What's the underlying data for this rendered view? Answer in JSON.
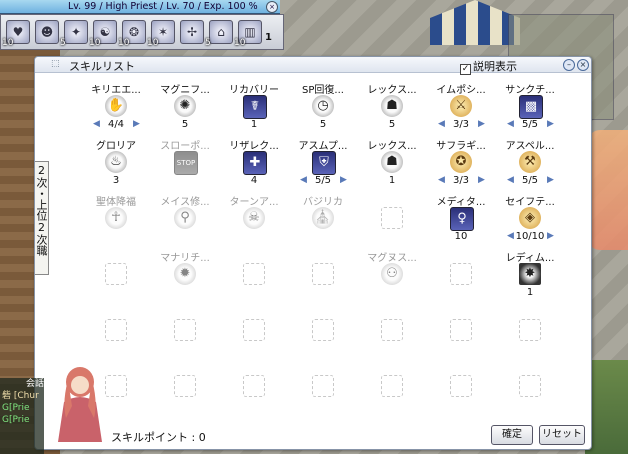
{
  "status_bar": {
    "text": "Lv. 99 / High Priest / Lv. 70 / Exp. 100 %"
  },
  "hotbar": {
    "slots": [
      {
        "icon": "heart-icon",
        "glyph": "♥",
        "count": "10"
      },
      {
        "icon": "face-icon",
        "glyph": "☻",
        "count": ""
      },
      {
        "icon": "skill-icon",
        "glyph": "✦",
        "count": "5"
      },
      {
        "icon": "skill-icon",
        "glyph": "☯",
        "count": "10"
      },
      {
        "icon": "skill-icon",
        "glyph": "❂",
        "count": "10"
      },
      {
        "icon": "skill-icon",
        "glyph": "✶",
        "count": "10"
      },
      {
        "icon": "skill-icon",
        "glyph": "✢",
        "count": ""
      },
      {
        "icon": "skill-icon",
        "glyph": "⌂",
        "count": "5"
      },
      {
        "icon": "skill-icon",
        "glyph": "▥",
        "count": "10"
      }
    ],
    "page_number": "1"
  },
  "skill_window": {
    "title": "スキルリスト",
    "description_toggle": "説明表示",
    "side_tab": "2次・上位2次職",
    "skill_points_label": "スキルポイント : 0",
    "confirm_label": "確定",
    "reset_label": "リセット",
    "rows": [
      [
        {
          "name": "キリエエ...",
          "glyph": "✋",
          "style": "round",
          "level": "4/4",
          "arrows": true
        },
        {
          "name": "マグニフ...",
          "glyph": "✺",
          "style": "round",
          "level": "5"
        },
        {
          "name": "リカバリー",
          "glyph": "☤",
          "style": "box",
          "level": "1"
        },
        {
          "name": "SP回復...",
          "glyph": "◷",
          "style": "round",
          "level": "5"
        },
        {
          "name": "レックス...",
          "glyph": "☗",
          "style": "round",
          "level": "5"
        },
        {
          "name": "イムポシ...",
          "glyph": "⚔",
          "style": "gold",
          "level": "3/3",
          "arrows": true
        },
        {
          "name": "サンクチ...",
          "glyph": "▩",
          "style": "box",
          "level": "5/5",
          "arrows": true
        }
      ],
      [
        {
          "name": "グロリア",
          "glyph": "♨",
          "style": "round",
          "level": "3"
        },
        {
          "name": "スローポ...",
          "glyph": "STOP",
          "style": "box",
          "level": "",
          "dim": true
        },
        {
          "name": "リザレク...",
          "glyph": "✚",
          "style": "box",
          "level": "4"
        },
        {
          "name": "アスムプ...",
          "glyph": "⛨",
          "style": "box",
          "level": "5/5",
          "arrows": true
        },
        {
          "name": "レックス...",
          "glyph": "☗",
          "style": "round",
          "level": "1"
        },
        {
          "name": "サフラギ...",
          "glyph": "✪",
          "style": "gold",
          "level": "3/3",
          "arrows": true
        },
        {
          "name": "アスペル...",
          "glyph": "⚒",
          "style": "gold",
          "level": "5/5",
          "arrows": true
        }
      ],
      [
        {
          "name": "聖体降福",
          "glyph": "☥",
          "style": "round",
          "level": "",
          "dim": true
        },
        {
          "name": "メイス修...",
          "glyph": "⚲",
          "style": "round",
          "level": "",
          "dim": true
        },
        {
          "name": "ターンア...",
          "glyph": "☠",
          "style": "round",
          "level": "",
          "dim": true
        },
        {
          "name": "バジリカ",
          "glyph": "⛪",
          "style": "round",
          "level": "",
          "dim": true
        },
        {
          "name": "",
          "glyph": "",
          "style": "empty",
          "level": ""
        },
        {
          "name": "メディタ...",
          "glyph": "♀",
          "style": "box",
          "level": "10"
        },
        {
          "name": "セイフテ...",
          "glyph": "◈",
          "style": "gold",
          "level": "10/10",
          "arrows": true
        }
      ],
      [
        {
          "name": "",
          "glyph": "",
          "style": "empty",
          "level": ""
        },
        {
          "name": "マナリチ...",
          "glyph": "✹",
          "style": "round",
          "level": "",
          "dim": true
        },
        {
          "name": "",
          "glyph": "",
          "style": "empty",
          "level": ""
        },
        {
          "name": "",
          "glyph": "",
          "style": "empty",
          "level": ""
        },
        {
          "name": "マグヌス...",
          "glyph": "⚇",
          "style": "round",
          "level": "",
          "dim": true
        },
        {
          "name": "",
          "glyph": "",
          "style": "empty",
          "level": ""
        },
        {
          "name": "レディム...",
          "glyph": "✸",
          "style": "burst",
          "level": "1"
        }
      ],
      [
        {
          "name": "",
          "glyph": "",
          "style": "empty",
          "level": ""
        },
        {
          "name": "",
          "glyph": "",
          "style": "empty",
          "level": ""
        },
        {
          "name": "",
          "glyph": "",
          "style": "empty",
          "level": ""
        },
        {
          "name": "",
          "glyph": "",
          "style": "empty",
          "level": ""
        },
        {
          "name": "",
          "glyph": "",
          "style": "empty",
          "level": ""
        },
        {
          "name": "",
          "glyph": "",
          "style": "empty",
          "level": ""
        },
        {
          "name": "",
          "glyph": "",
          "style": "empty",
          "level": ""
        }
      ],
      [
        {
          "name": "",
          "glyph": "",
          "style": "empty",
          "level": ""
        },
        {
          "name": "",
          "glyph": "",
          "style": "empty",
          "level": ""
        },
        {
          "name": "",
          "glyph": "",
          "style": "empty",
          "level": ""
        },
        {
          "name": "",
          "glyph": "",
          "style": "empty",
          "level": ""
        },
        {
          "name": "",
          "glyph": "",
          "style": "empty",
          "level": ""
        },
        {
          "name": "",
          "glyph": "",
          "style": "empty",
          "level": ""
        },
        {
          "name": "",
          "glyph": "",
          "style": "empty",
          "level": ""
        }
      ]
    ]
  },
  "chat": {
    "tab_label": "会話",
    "lines": [
      "砦 [Chur",
      "G[Prie",
      "G[Prie"
    ]
  }
}
